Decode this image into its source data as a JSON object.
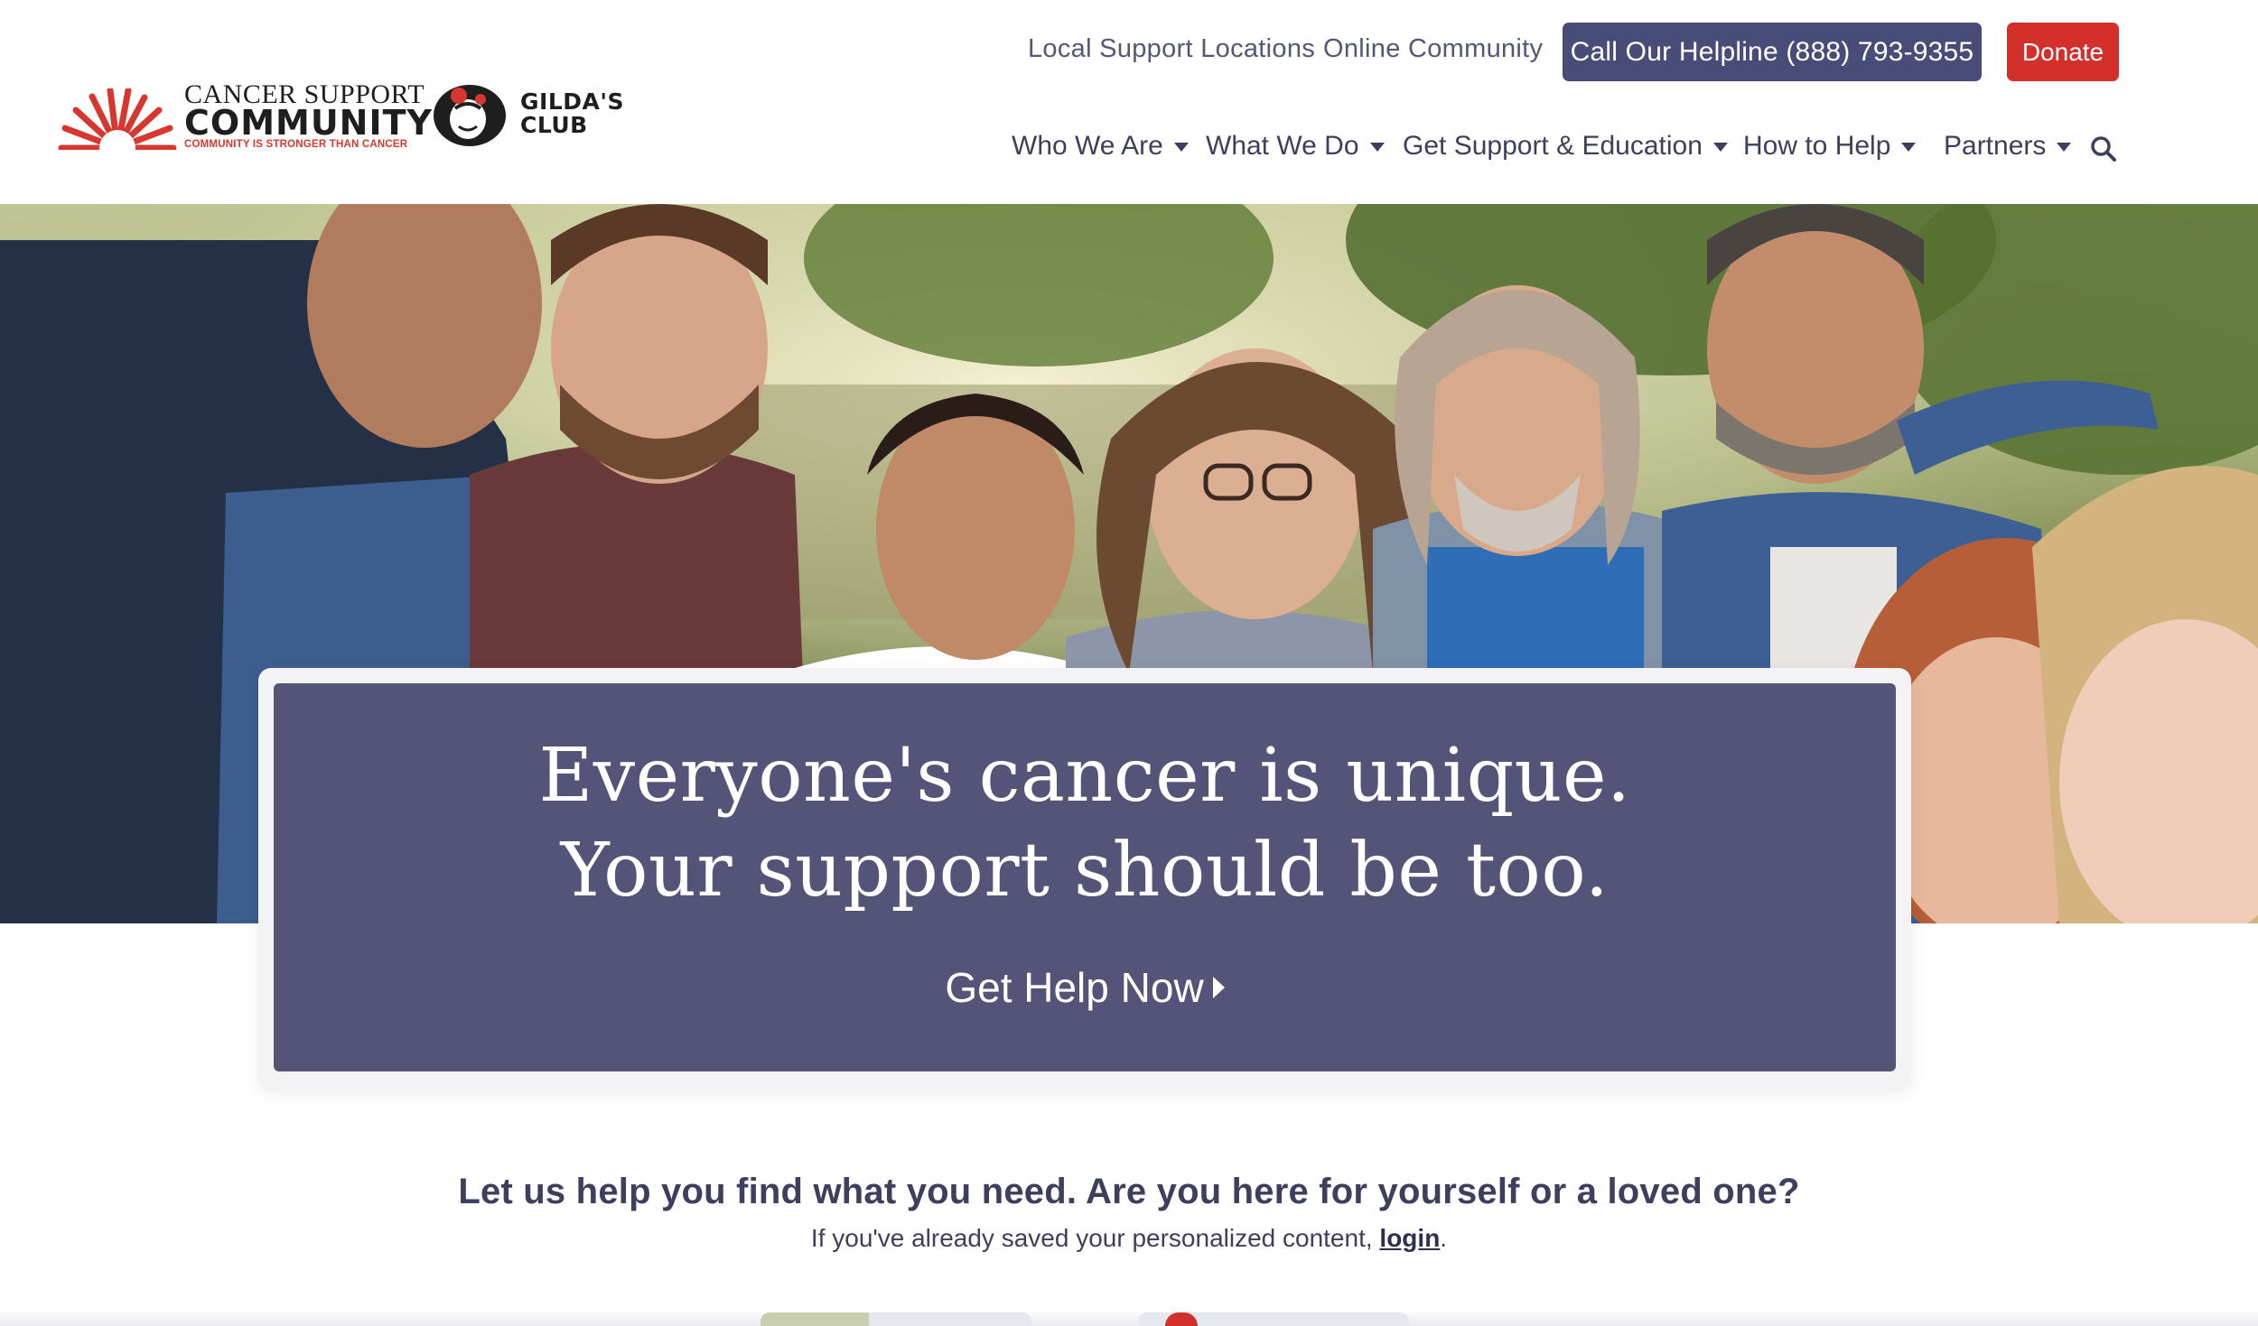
{
  "brand": {
    "logo_line1": "CANCER SUPPORT",
    "logo_line2": "COMMUNITY",
    "logo_tagline": "COMMUNITY IS STRONGER THAN CANCER",
    "partner_line1": "GILDA'S",
    "partner_line2": "CLUB",
    "brand_red": "#d3302c",
    "brand_purple": "#4a4c78"
  },
  "utility_nav": {
    "local_support": "Local Support Locations",
    "online_community": "Online Community",
    "helpline": "Call Our Helpline (888) 793-9355",
    "donate": "Donate"
  },
  "main_nav": [
    {
      "label": "Who We Are"
    },
    {
      "label": "What We Do"
    },
    {
      "label": "Get Support & Education"
    },
    {
      "label": "How to Help"
    },
    {
      "label": "Partners"
    }
  ],
  "hero": {
    "headline_line1": "Everyone's cancer is unique.",
    "headline_line2": "Your support should be too.",
    "cta": "Get Help Now",
    "card_color": "#545479"
  },
  "intro": {
    "question": "Let us help you find what you need. Are you here for yourself or a loved one?",
    "saved_prefix": "If you've already saved your personalized content, ",
    "login_link": "login",
    "saved_suffix": "."
  }
}
